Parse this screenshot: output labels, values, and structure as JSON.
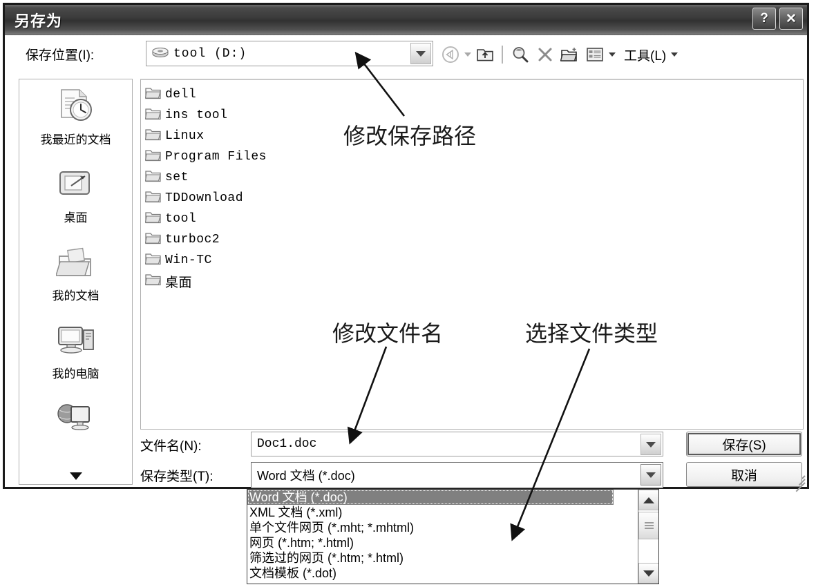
{
  "window": {
    "title": "另存为",
    "help_button": "?",
    "close_button": "✕"
  },
  "toolbar": {
    "save_in_label": "保存位置(I):",
    "path_value": "tool (D:)",
    "path_icon": "drive-icon",
    "buttons": [
      {
        "name": "back-icon",
        "label": "后退"
      },
      {
        "name": "up-folder-icon",
        "label": "向上一级"
      },
      {
        "name": "search-icon",
        "label": "搜索"
      },
      {
        "name": "delete-icon",
        "label": "删除"
      },
      {
        "name": "new-folder-icon",
        "label": "新建文件夹"
      },
      {
        "name": "views-icon",
        "label": "查看"
      }
    ],
    "tools_menu": "工具(L)"
  },
  "places": [
    {
      "label": "我最近的文档",
      "icon": "recent-documents-icon"
    },
    {
      "label": "桌面",
      "icon": "desktop-icon"
    },
    {
      "label": "我的文档",
      "icon": "my-documents-icon"
    },
    {
      "label": "我的电脑",
      "icon": "my-computer-icon"
    },
    {
      "label": "",
      "icon": "my-network-places-icon"
    }
  ],
  "files": [
    {
      "name": "dell",
      "type": "folder",
      "cjk": false
    },
    {
      "name": "ins tool",
      "type": "folder",
      "cjk": false
    },
    {
      "name": "Linux",
      "type": "folder",
      "cjk": false
    },
    {
      "name": "Program Files",
      "type": "folder",
      "cjk": false
    },
    {
      "name": "set",
      "type": "folder",
      "cjk": false
    },
    {
      "name": "TDDownload",
      "type": "folder",
      "cjk": false
    },
    {
      "name": "tool",
      "type": "folder",
      "cjk": false
    },
    {
      "name": "turboc2",
      "type": "folder",
      "cjk": false
    },
    {
      "name": "Win-TC",
      "type": "folder",
      "cjk": false
    },
    {
      "name": "桌面",
      "type": "folder",
      "cjk": true
    }
  ],
  "fields": {
    "filename_label": "文件名(N):",
    "filename_value": "Doc1.doc",
    "filetype_label": "保存类型(T):",
    "filetype_value": "Word 文档 (*.doc)"
  },
  "buttons": {
    "save": "保存(S)",
    "cancel": "取消"
  },
  "dropdown": {
    "selected_index": 0,
    "items": [
      "Word 文档 (*.doc)",
      "XML 文档 (*.xml)",
      "单个文件网页 (*.mht; *.mhtml)",
      "网页 (*.htm; *.html)",
      "筛选过的网页 (*.htm; *.html)",
      "文档模板 (*.dot)"
    ]
  },
  "annotations": [
    {
      "id": "anno-path",
      "text": "修改保存路径"
    },
    {
      "id": "anno-fname",
      "text": "修改文件名"
    },
    {
      "id": "anno-ftype",
      "text": "选择文件类型"
    }
  ],
  "colors": {
    "titlebar": "#3b3b3b",
    "selection": "#808080",
    "dialog_border": "#1a1a1a",
    "panel_border": "#aeaeae"
  }
}
